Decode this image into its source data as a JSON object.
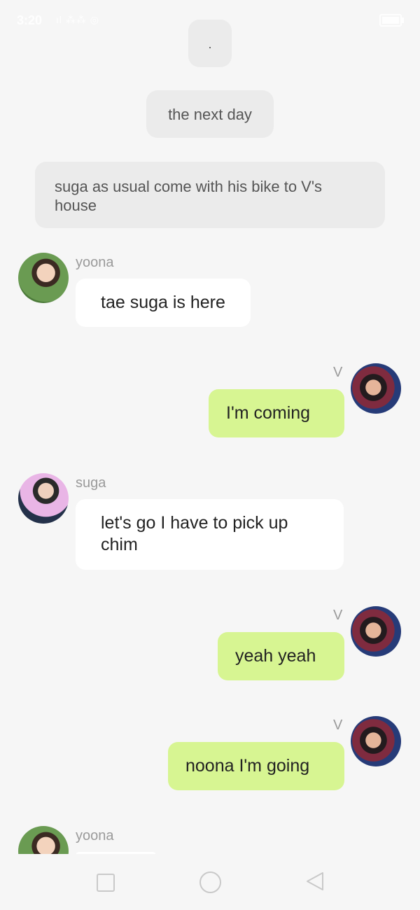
{
  "status_bar": {
    "time": "3:20",
    "signal": "ıl ⁂⁂ ◎"
  },
  "notes": [
    ".",
    "the next day",
    "suga as usual come with his bike to V's house"
  ],
  "messages": [
    {
      "sender": "yoona",
      "text": "tae suga is here",
      "side": "left",
      "icon": "yoona-avatar-icon"
    },
    {
      "sender": "V",
      "text": "I'm coming",
      "side": "right",
      "icon": "v-avatar-icon"
    },
    {
      "sender": "suga",
      "text": "let's go I have to pick up chim",
      "side": "left",
      "icon": "suga-avatar-icon"
    },
    {
      "sender": "V",
      "text": "yeah yeah",
      "side": "right",
      "icon": "v-avatar-icon"
    },
    {
      "sender": "V",
      "text": "noona I'm going",
      "side": "right",
      "icon": "v-avatar-icon"
    },
    {
      "sender": "yoona",
      "text": "",
      "side": "left",
      "icon": "yoona-avatar-icon"
    }
  ],
  "colors": {
    "background": "#f6f6f6",
    "left_bubble": "#ffffff",
    "right_bubble": "#d7f592",
    "note_bubble": "#ebebeb"
  },
  "nav_bar": {
    "recent_icon": "square-icon",
    "home_icon": "circle-icon",
    "back_icon": "triangle-back-icon"
  }
}
